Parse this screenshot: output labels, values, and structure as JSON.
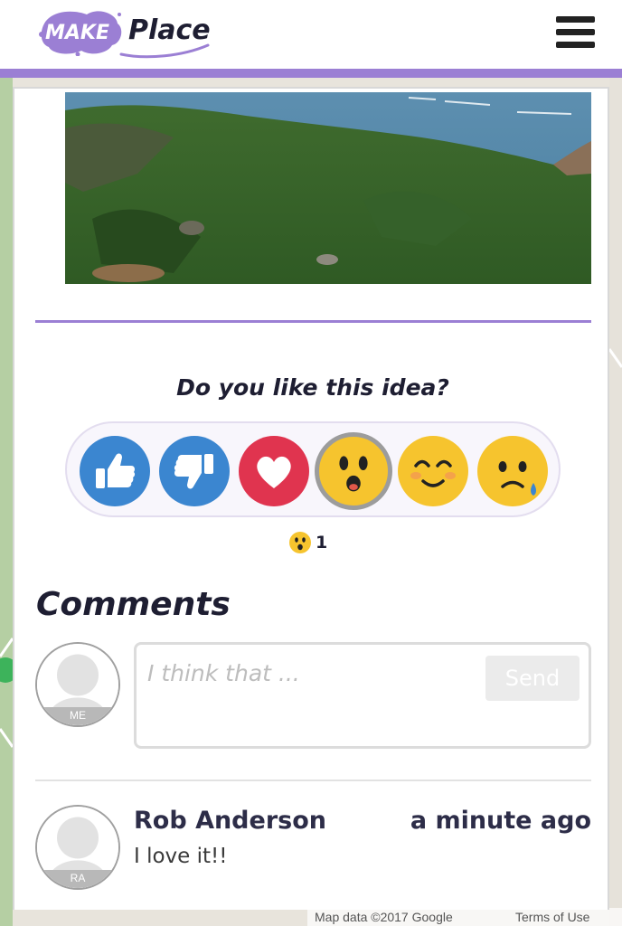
{
  "header": {
    "logo_make": "MAKE",
    "logo_place": "Place",
    "brand_color": "#9b7fd4",
    "menu_icon": "hamburger-menu-icon"
  },
  "map": {
    "attribution": "Map data ©2017 Google",
    "terms": "Terms of Use"
  },
  "idea": {
    "photo": "coastal-hillside-photo"
  },
  "reactions": {
    "question": "Do you like this idea?",
    "items": [
      {
        "name": "thumbs-up",
        "color": "#3b86d0"
      },
      {
        "name": "thumbs-down",
        "color": "#3b86d0"
      },
      {
        "name": "heart",
        "color": "#e0344f"
      },
      {
        "name": "surprised",
        "color": "#f6c42e",
        "selected": true
      },
      {
        "name": "happy",
        "color": "#f6c42e"
      },
      {
        "name": "sad",
        "color": "#f6c42e"
      }
    ],
    "selected_count": "1"
  },
  "comments": {
    "title": "Comments",
    "input_placeholder": "I think that ...",
    "send_label": "Send",
    "me_initials": "ME",
    "list": [
      {
        "initials": "RA",
        "author": "Rob Anderson",
        "time": "a minute ago",
        "text": "I love it!!"
      }
    ]
  }
}
